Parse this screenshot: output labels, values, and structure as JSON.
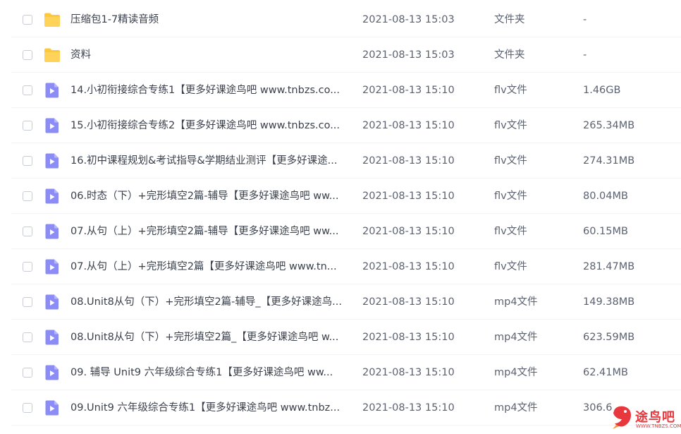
{
  "files": [
    {
      "kind": "folder",
      "name": "压缩包1-7精读音频",
      "date": "2021-08-13 15:03",
      "type": "文件夹",
      "size": "-"
    },
    {
      "kind": "folder",
      "name": "资料",
      "date": "2021-08-13 15:03",
      "type": "文件夹",
      "size": "-"
    },
    {
      "kind": "video",
      "name": "14.小初衔接综合专练1【更多好课途鸟吧 www.tnbzs.co...",
      "date": "2021-08-13 15:10",
      "type": "flv文件",
      "size": "1.46GB"
    },
    {
      "kind": "video",
      "name": "15.小初衔接综合专练2【更多好课途鸟吧 www.tnbzs.co...",
      "date": "2021-08-13 15:10",
      "type": "flv文件",
      "size": "265.34MB"
    },
    {
      "kind": "video",
      "name": "16.初中课程规划&考试指导&学期结业测评【更多好课途...",
      "date": "2021-08-13 15:10",
      "type": "flv文件",
      "size": "274.31MB"
    },
    {
      "kind": "video",
      "name": "06.时态（下）+完形填空2篇-辅导【更多好课途鸟吧 ww...",
      "date": "2021-08-13 15:10",
      "type": "flv文件",
      "size": "80.04MB"
    },
    {
      "kind": "video",
      "name": "07.从句（上）+完形填空2篇-辅导【更多好课途鸟吧 ww...",
      "date": "2021-08-13 15:10",
      "type": "flv文件",
      "size": "60.15MB"
    },
    {
      "kind": "video",
      "name": "07.从句（上）+完形填空2篇【更多好课途鸟吧 www.tn...",
      "date": "2021-08-13 15:10",
      "type": "flv文件",
      "size": "281.47MB"
    },
    {
      "kind": "video",
      "name": "08.Unit8从句（下）+完形填空2篇-辅导_【更多好课途鸟...",
      "date": "2021-08-13 15:10",
      "type": "mp4文件",
      "size": "149.38MB"
    },
    {
      "kind": "video",
      "name": "08.Unit8从句（下）+完形填空2篇_【更多好课途鸟吧 w...",
      "date": "2021-08-13 15:10",
      "type": "mp4文件",
      "size": "623.59MB"
    },
    {
      "kind": "video",
      "name": "09. 辅导 Unit9 六年级综合专练1【更多好课途鸟吧 ww...",
      "date": "2021-08-13 15:10",
      "type": "mp4文件",
      "size": "62.41MB"
    },
    {
      "kind": "video",
      "name": "09.Unit9 六年级综合专练1【更多好课途鸟吧 www.tnbz...",
      "date": "2021-08-13 15:10",
      "type": "mp4文件",
      "size": "306.6"
    }
  ],
  "watermark": {
    "text": "途鸟吧",
    "sub": "WWW.TNBZS.COM"
  },
  "colors": {
    "folder": "#fdc83a",
    "video": "#8b8cf6",
    "text": "#3a414c",
    "muted": "#5b6270"
  }
}
